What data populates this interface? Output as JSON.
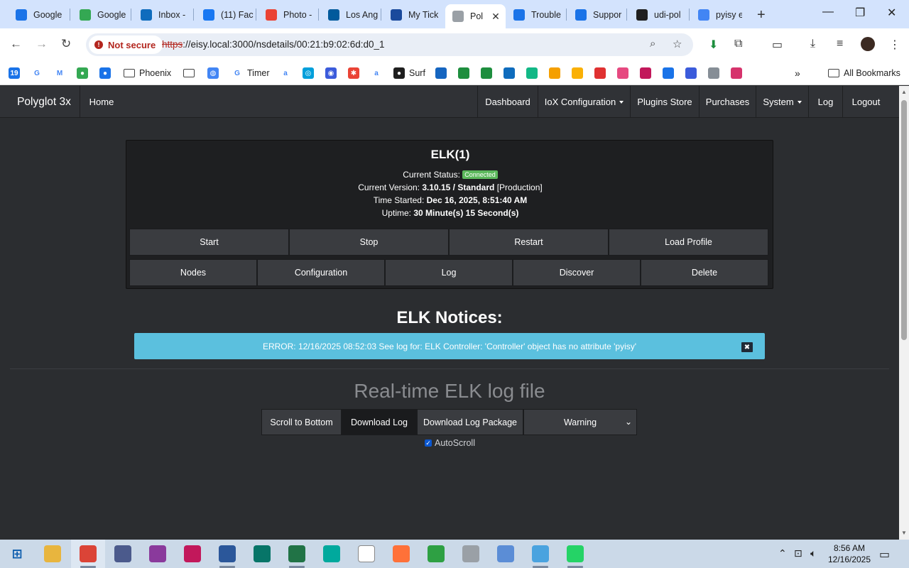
{
  "browser": {
    "tabs": [
      {
        "title": "Google",
        "icon": "google-calendar-icon",
        "color": "#1a73e8"
      },
      {
        "title": "Google",
        "icon": "google-maps-icon",
        "color": "#34a853"
      },
      {
        "title": "Inbox -",
        "icon": "outlook-icon",
        "color": "#0f6cbd"
      },
      {
        "title": "(11) Fac",
        "icon": "facebook-icon",
        "color": "#1877f2"
      },
      {
        "title": "Photo -",
        "icon": "google-photos-icon",
        "color": "#ea4335"
      },
      {
        "title": "Los Ang",
        "icon": "dodgers-icon",
        "color": "#005a9c"
      },
      {
        "title": "My Tick",
        "icon": "ticket-icon",
        "color": "#1a4a9c"
      },
      {
        "title": "Pol",
        "icon": "polyglot-icon",
        "color": "#9aa0a6"
      },
      {
        "title": "Trouble",
        "icon": "udi-icon",
        "color": "#1a73e8"
      },
      {
        "title": "Suppor",
        "icon": "udi-icon",
        "color": "#1a73e8"
      },
      {
        "title": "udi-pol",
        "icon": "github-icon",
        "color": "#1f1f1f"
      },
      {
        "title": "pyisy el",
        "icon": "google-icon",
        "color": "#4285f4"
      }
    ],
    "active_tab_close": "✕",
    "new_tab": "+",
    "security_label": "Not secure",
    "url_protocol": "https",
    "url_rest": "://eisy.local:3000/nsdetails/00:21:b9:02:6d:d0_1",
    "bookmarks": [
      {
        "label": "",
        "icon": "calendar-icon",
        "color": "#1a73e8",
        "glyph": "19"
      },
      {
        "label": "",
        "icon": "google-icon",
        "color": "#ffffff",
        "glyph": "G"
      },
      {
        "label": "",
        "icon": "gmail-icon",
        "color": "#ffffff",
        "glyph": "M"
      },
      {
        "label": "",
        "icon": "maps-icon",
        "color": "#34a853",
        "glyph": "●"
      },
      {
        "label": "",
        "icon": "person-icon",
        "color": "#1a73e8",
        "glyph": "●"
      },
      {
        "label": "Phoenix",
        "icon": "folder-icon"
      },
      {
        "label": "",
        "icon": "folder-icon"
      },
      {
        "label": "",
        "icon": "globe-icon",
        "color": "#4285f4",
        "glyph": "◍"
      },
      {
        "label": "Timer",
        "icon": "google-icon",
        "color": "#ffffff",
        "glyph": "G"
      },
      {
        "label": "",
        "icon": "amazon-icon",
        "color": "#ffffff",
        "glyph": "a"
      },
      {
        "label": "",
        "icon": "att-icon",
        "color": "#009fdb",
        "glyph": "◎"
      },
      {
        "label": "",
        "icon": "bookmark-icon",
        "color": "#3b5bdb",
        "glyph": "◉"
      },
      {
        "label": "",
        "icon": "pinwheel-icon",
        "color": "#ea4335",
        "glyph": "✱"
      },
      {
        "label": "",
        "icon": "amazon-icon",
        "color": "#ffffff",
        "glyph": "a"
      },
      {
        "label": "Surf",
        "icon": "drop-icon",
        "color": "#1f1f1f",
        "glyph": "●"
      }
    ],
    "all_bookmarks": "All Bookmarks"
  },
  "polyglot": {
    "brand": "Polyglot 3x",
    "home": "Home",
    "nav": [
      {
        "label": "Dashboard",
        "dropdown": false
      },
      {
        "label": "IoX Configuration",
        "dropdown": true
      },
      {
        "label": "Plugins Store",
        "dropdown": false
      },
      {
        "label": "Purchases",
        "dropdown": false
      },
      {
        "label": "System",
        "dropdown": true
      },
      {
        "label": "Log",
        "dropdown": false
      },
      {
        "label": "Logout",
        "dropdown": false
      }
    ],
    "node": {
      "title": "ELK(1)",
      "status_label": "Current Status:",
      "status_value": "Connected",
      "status_color": "#5cb85c",
      "version_label": "Current Version:",
      "version_value": "3.10.15 / Standard",
      "version_suffix": "[Production]",
      "started_label": "Time Started:",
      "started_value": "Dec 16, 2025, 8:51:40 AM",
      "uptime_label": "Uptime:",
      "uptime_value": "30 Minute(s) 15 Second(s)"
    },
    "actions_row1": [
      "Start",
      "Stop",
      "Restart",
      "Load Profile"
    ],
    "actions_row2": [
      "Nodes",
      "Configuration",
      "Log",
      "Discover",
      "Delete"
    ],
    "notices_title": "ELK Notices:",
    "notice_text": "ERROR: 12/16/2025 08:52:03 See log for: ELK Controller: 'Controller' object has no attribute 'pyisy'",
    "notice_close": "✖",
    "notice_color": "#5bc0de",
    "log_title": "Real-time ELK log file",
    "log_buttons": [
      "Scroll to Bottom",
      "Download Log",
      "Download Log Package"
    ],
    "log_level": "Warning",
    "autoscroll_label": "AutoScroll",
    "autoscroll_checked": true
  },
  "taskbar": {
    "apps": [
      {
        "icon": "file-explorer-icon",
        "color": "#e8b53e"
      },
      {
        "icon": "chrome-icon",
        "color": "#db4437"
      },
      {
        "icon": "app-icon",
        "color": "#4b5a8c"
      },
      {
        "icon": "winrar-icon",
        "color": "#8a3a9c"
      },
      {
        "icon": "pdf-editor-icon",
        "color": "#c2185b"
      },
      {
        "icon": "word-icon",
        "color": "#2b579a"
      },
      {
        "icon": "publisher-icon",
        "color": "#077568"
      },
      {
        "icon": "excel-icon",
        "color": "#217346"
      },
      {
        "icon": "app-icon",
        "color": "#00a99d"
      },
      {
        "icon": "notepad-icon",
        "color": "#ffffff"
      },
      {
        "icon": "firefox-icon",
        "color": "#ff7139"
      },
      {
        "icon": "app-icon",
        "color": "#2ea043"
      },
      {
        "icon": "clock-app-icon",
        "color": "#9aa0a6"
      },
      {
        "icon": "paint-icon",
        "color": "#5b8dd6"
      },
      {
        "icon": "app-icon",
        "color": "#4aa3df"
      },
      {
        "icon": "whatsapp-icon",
        "color": "#25d366"
      }
    ],
    "time": "8:56 AM",
    "date": "12/16/2025"
  }
}
